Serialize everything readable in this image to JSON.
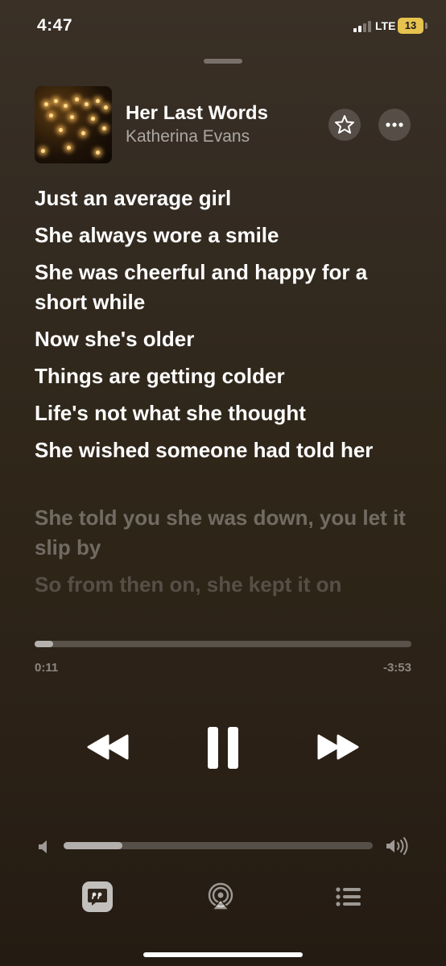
{
  "status_bar": {
    "time": "4:47",
    "network": "LTE",
    "battery": "13",
    "battery_color": "#e6c24e"
  },
  "now_playing": {
    "title": "Her Last Words",
    "artist": "Katherina Evans",
    "favorite_icon": "star-outline-icon",
    "more_icon": "ellipsis-icon"
  },
  "lyrics": {
    "active_lines": [
      "Just an average girl",
      "She always wore a smile",
      "She was cheerful and happy for a short while",
      "Now she's older",
      "Things are getting colder",
      "Life's not what she thought",
      "She wished someone had told her"
    ],
    "upcoming_lines": [
      "She told you she was down, you let it slip by",
      "So from then on, she kept it on"
    ]
  },
  "playback": {
    "elapsed": "0:11",
    "remaining": "-3:53",
    "progress_fraction": 0.05,
    "volume_fraction": 0.19
  },
  "controls": {
    "previous_icon": "rewind-icon",
    "playpause_icon": "pause-icon",
    "next_icon": "fast-forward-icon"
  },
  "bottom_bar": {
    "lyrics_icon": "lyrics-quote-icon",
    "airplay_icon": "airplay-audio-icon",
    "queue_icon": "queue-list-icon"
  }
}
